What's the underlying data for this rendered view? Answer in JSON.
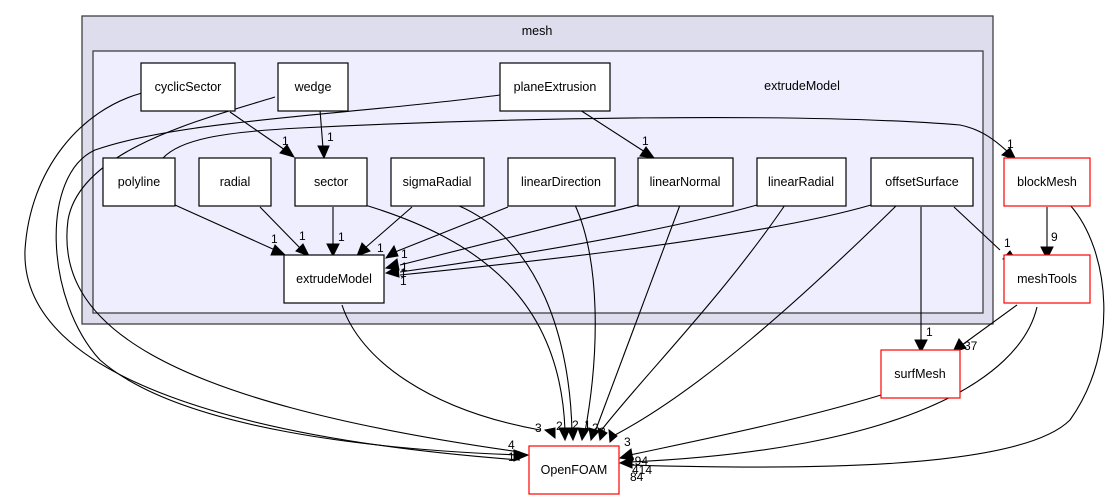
{
  "clusters": {
    "outer": {
      "label": "mesh"
    },
    "inner": {
      "label": "extrudeModel"
    }
  },
  "nodes": {
    "cyclicSector": "cyclicSector",
    "wedge": "wedge",
    "planeExtrusion": "planeExtrusion",
    "polyline": "polyline",
    "radial": "radial",
    "sector": "sector",
    "sigmaRadial": "sigmaRadial",
    "linearDirection": "linearDirection",
    "linearNormal": "linearNormal",
    "linearRadial": "linearRadial",
    "offsetSurface": "offsetSurface",
    "extrudeModel": "extrudeModel",
    "blockMesh": "blockMesh",
    "meshTools": "meshTools",
    "surfMesh": "surfMesh",
    "OpenFOAM": "OpenFOAM"
  },
  "edge_labels": {
    "cyclicSector_sector": "1",
    "wedge_sector": "1",
    "planeExtrusion_linearNormal": "1",
    "polyline_blockMesh": "1",
    "polyline_extrudeModel": "1",
    "radial_extrudeModel": "1",
    "sector_extrudeModel": "1",
    "sigmaRadial_extrudeModel": "1",
    "linearDirection_extrudeModel": "1",
    "linearNormal_extrudeModel": "1",
    "linearRadial_extrudeModel": "1",
    "offsetSurface_extrudeModel": "1",
    "offsetSurface_meshTools": "1",
    "offsetSurface_surfMesh": "1",
    "blockMesh_meshTools": "9",
    "meshTools_surfMesh": "37",
    "extrudeModel_OpenFOAM": "3",
    "sector_OpenFOAM": "2",
    "sigmaRadial_OpenFOAM": "2",
    "linearDirection_OpenFOAM": "1",
    "linearNormal_OpenFOAM": "2",
    "linearRadial_OpenFOAM": "3",
    "offsetSurface_OpenFOAM": "3",
    "cyclicSector_OpenFOAM": "4",
    "wedge_OpenFOAM": "1",
    "surfMesh_OpenFOAM": "294",
    "meshTools_OpenFOAM": "414",
    "blockMesh_OpenFOAM": "84"
  }
}
